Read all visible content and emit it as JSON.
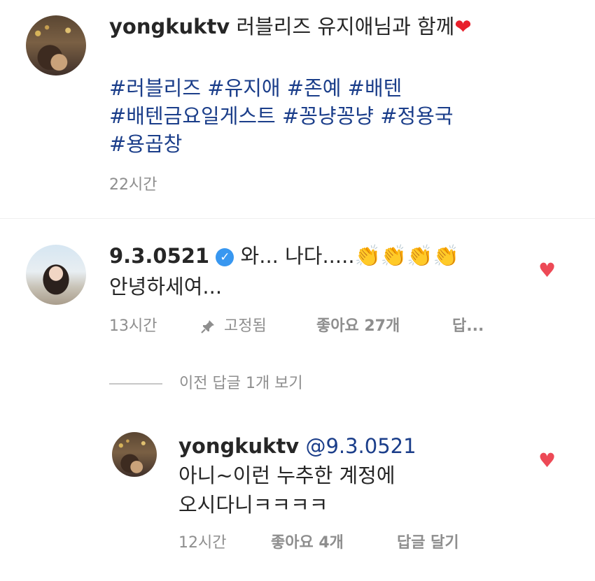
{
  "post": {
    "username": "yongkuktv",
    "caption": "러블리즈 유지애님과 함께",
    "caption_emoji": "❤",
    "hashtags_line1": "#러블리즈 #유지애 #존예 #배텐",
    "hashtags_line2": "#배텐금요일게스트 #꽁냥꽁냥 #정용국",
    "hashtags_line3": "#용곱창",
    "time": "22시간"
  },
  "comment": {
    "username": "9.3.0521",
    "verified_glyph": "✓",
    "text_line1": "와... 나다.....",
    "claps": "👏👏👏👏",
    "text_line2": "안녕하세여...",
    "time": "13시간",
    "pin_icon": "pin-icon",
    "pinned_label": "고정됨",
    "likes_label": "좋아요 27개",
    "reply_label": "답...",
    "heart_glyph": "♥"
  },
  "view_replies_label": "이전 답글 1개 보기",
  "reply": {
    "username": "yongkuktv",
    "mention": "@9.3.0521",
    "text_line1": "아니~이런 누추한 계정에",
    "text_line2": "오시다니ㅋㅋㅋㅋ",
    "time": "12시간",
    "likes_label": "좋아요 4개",
    "reply_label": "답글 달기",
    "heart_glyph": "♥"
  },
  "colors": {
    "hashtag": "#1b3e8a",
    "meta_grey": "#8e8e8e",
    "like_red": "#ed4956",
    "verified_blue": "#3897f0"
  }
}
